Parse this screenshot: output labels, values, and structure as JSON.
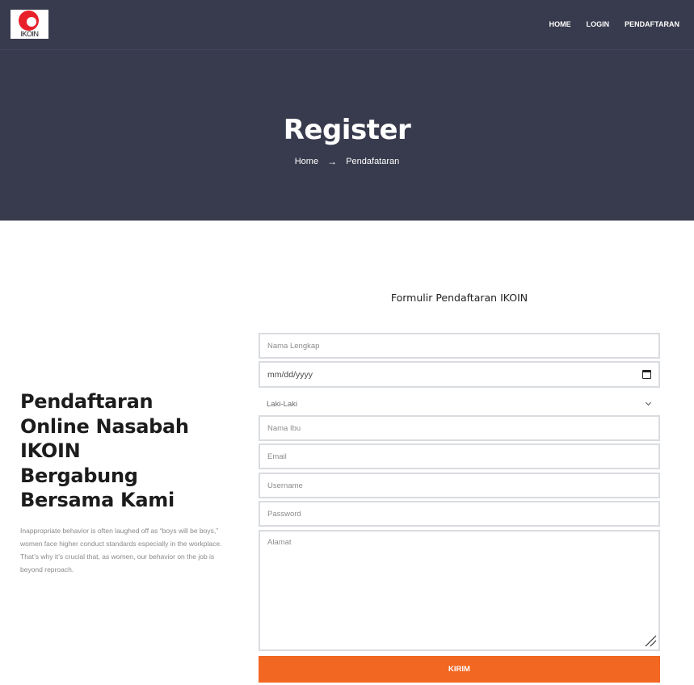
{
  "brand": {
    "logo_text": "IKOIN"
  },
  "nav": {
    "items": [
      "HOME",
      "LOGIN",
      "PENDAFTARAN"
    ]
  },
  "hero": {
    "title": "Register",
    "breadcrumb": {
      "home": "Home",
      "separator": "→",
      "current": "Pendafataran"
    }
  },
  "intro": {
    "heading_lines": [
      "Pendaftaran",
      "Online Nasabah",
      "IKOIN",
      "Bergabung",
      "Bersama Kami"
    ],
    "paragraph": "Inappropriate behavior is often laughed off as “boys will be boys,” women face higher conduct standards especially in the workplace. That’s why it’s crucial that, as women, our behavior on the job is beyond reproach."
  },
  "form": {
    "title": "Formulir Pendaftaran IKOIN",
    "full_name_placeholder": "Nama Lengkap",
    "birthdate_placeholder": "mm/dd/yyyy",
    "gender_value": "Laki-Laki",
    "mother_name_placeholder": "Nama Ibu",
    "email_placeholder": "Email",
    "username_placeholder": "Username",
    "password_placeholder": "Password",
    "address_placeholder": "Alamat",
    "submit_label": "KIRIM"
  },
  "colors": {
    "hero_bg": "#383b4d",
    "accent": "#f26722",
    "logo_red": "#e8202a"
  }
}
